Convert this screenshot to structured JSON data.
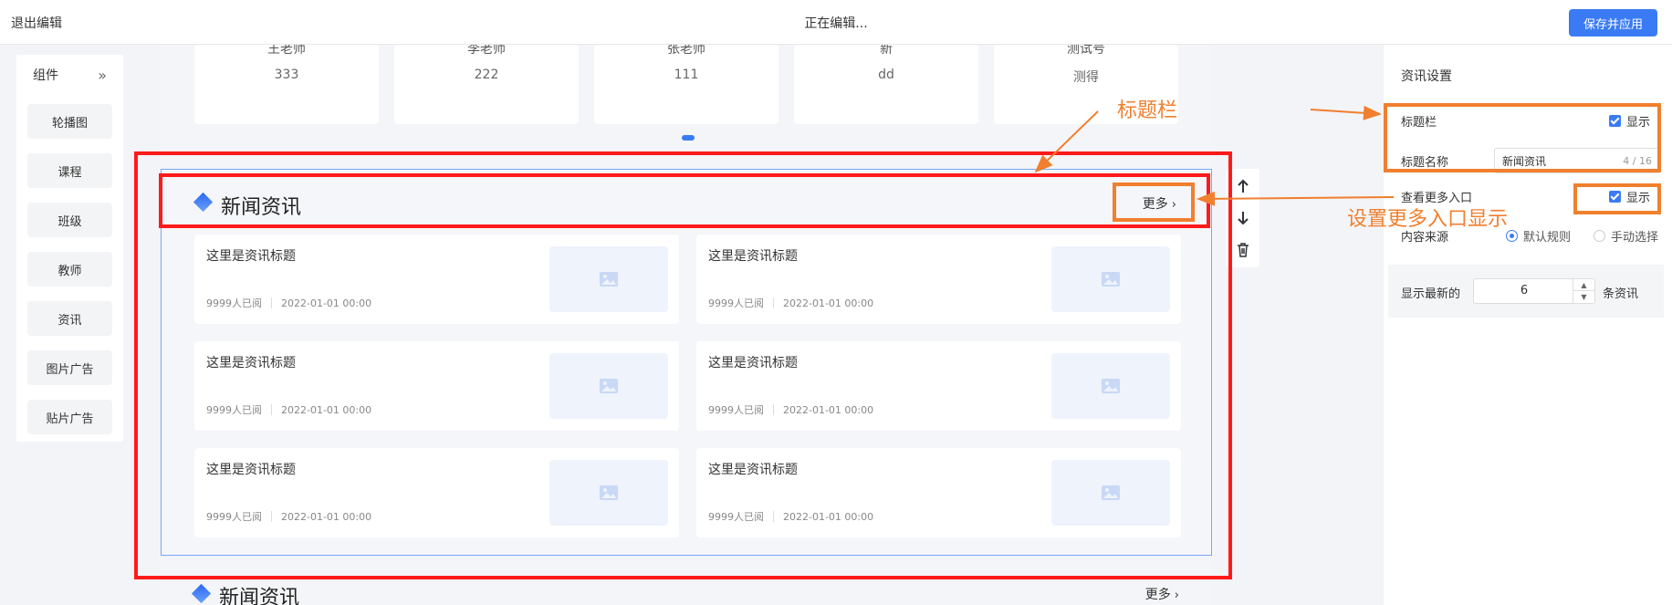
{
  "topbar": {
    "exit_label": "退出编辑",
    "status_text": "正在编辑...",
    "save_label": "保存并应用"
  },
  "components": {
    "title": "组件",
    "items": [
      {
        "label": "轮播图"
      },
      {
        "label": "课程"
      },
      {
        "label": "班级"
      },
      {
        "label": "教师"
      },
      {
        "label": "资讯"
      },
      {
        "label": "图片广告"
      },
      {
        "label": "贴片广告"
      }
    ]
  },
  "teachers": [
    {
      "name": "王老师",
      "value": "333"
    },
    {
      "name": "李老师",
      "value": "222"
    },
    {
      "name": "张老师",
      "value": "111"
    },
    {
      "name": "新",
      "value": "dd"
    },
    {
      "name": "测试号",
      "value": "测得"
    }
  ],
  "news_module": {
    "title": "新闻资讯",
    "more_label": "更多",
    "cards": [
      {
        "title": "这里是资讯标题",
        "views": "9999人已阅",
        "date": "2022-01-01 00:00"
      },
      {
        "title": "这里是资讯标题",
        "views": "9999人已阅",
        "date": "2022-01-01 00:00"
      },
      {
        "title": "这里是资讯标题",
        "views": "9999人已阅",
        "date": "2022-01-01 00:00"
      },
      {
        "title": "这里是资讯标题",
        "views": "9999人已阅",
        "date": "2022-01-01 00:00"
      },
      {
        "title": "这里是资讯标题",
        "views": "9999人已阅",
        "date": "2022-01-01 00:00"
      },
      {
        "title": "这里是资讯标题",
        "views": "9999人已阅",
        "date": "2022-01-01 00:00"
      }
    ]
  },
  "news_module_2": {
    "title": "新闻资讯",
    "more_label": "更多"
  },
  "settings": {
    "title": "资讯设置",
    "title_bar_label": "标题栏",
    "title_bar_show": "显示",
    "title_name_label": "标题名称",
    "title_name_value": "新闻资讯",
    "title_name_counter": "4 / 16",
    "view_more_label": "查看更多入口",
    "view_more_show": "显示",
    "source_label": "内容来源",
    "source_default": "默认规则",
    "source_manual": "手动选择",
    "count_prefix": "显示最新的",
    "count_value": "6",
    "count_suffix": "条资讯"
  },
  "annotations": {
    "title_bar_note": "标题栏",
    "more_entry_note": "设置更多入口显示"
  },
  "colors": {
    "accent": "#3a7bf5",
    "annotation_red": "#ff1a1a",
    "annotation_orange": "#f07f2e"
  }
}
